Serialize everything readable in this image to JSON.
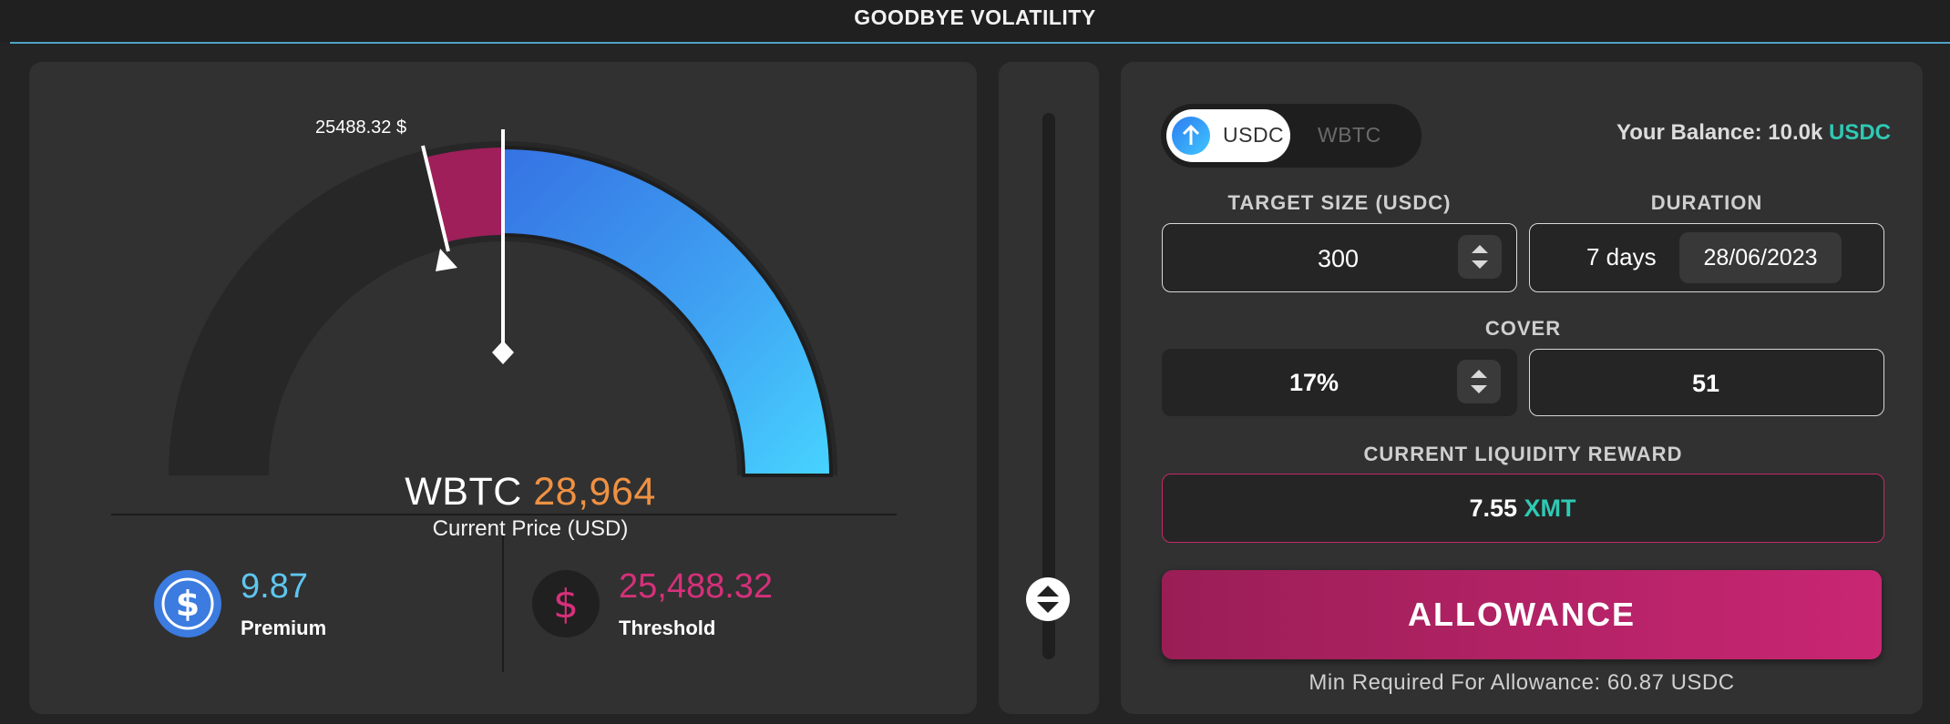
{
  "header": {
    "title": "GOODBYE VOLATILITY"
  },
  "gauge": {
    "threshold_tag": "25488.32 $",
    "asset": "WBTC",
    "price": "28,964",
    "price_caption": "Current Price (USD)"
  },
  "stats": {
    "premium": {
      "value": "9.87",
      "label": "Premium"
    },
    "threshold": {
      "value": "25,488.32",
      "label": "Threshold"
    }
  },
  "form": {
    "toggle": {
      "selected": "USDC",
      "other": "WBTC"
    },
    "balance": {
      "label": "Your Balance: 10.0k",
      "currency": "USDC"
    },
    "target_size": {
      "label": "TARGET SIZE (USDC)",
      "value": "300"
    },
    "duration": {
      "label": "DURATION",
      "days": "7 days",
      "date": "28/06/2023"
    },
    "cover": {
      "label": "COVER",
      "percent": "17%",
      "amount": "51"
    },
    "reward": {
      "label": "CURRENT LIQUIDITY REWARD",
      "value": "7.55",
      "token": "XMT"
    },
    "allowance_button": "ALLOWANCE",
    "min_required": "Min Required For Allowance: 60.87 USDC"
  },
  "colors": {
    "accent_orange": "#ef9142",
    "teal": "#2fc9b4",
    "pink": "#c42a66",
    "premium_blue": "#5ec6f0",
    "threshold_pink": "#d6307a"
  },
  "icons": {
    "premium": "usdc-coin-icon",
    "threshold": "dollar-icon",
    "toggle": "arrow-up-icon",
    "stepper": "up-down-arrows-icon"
  }
}
